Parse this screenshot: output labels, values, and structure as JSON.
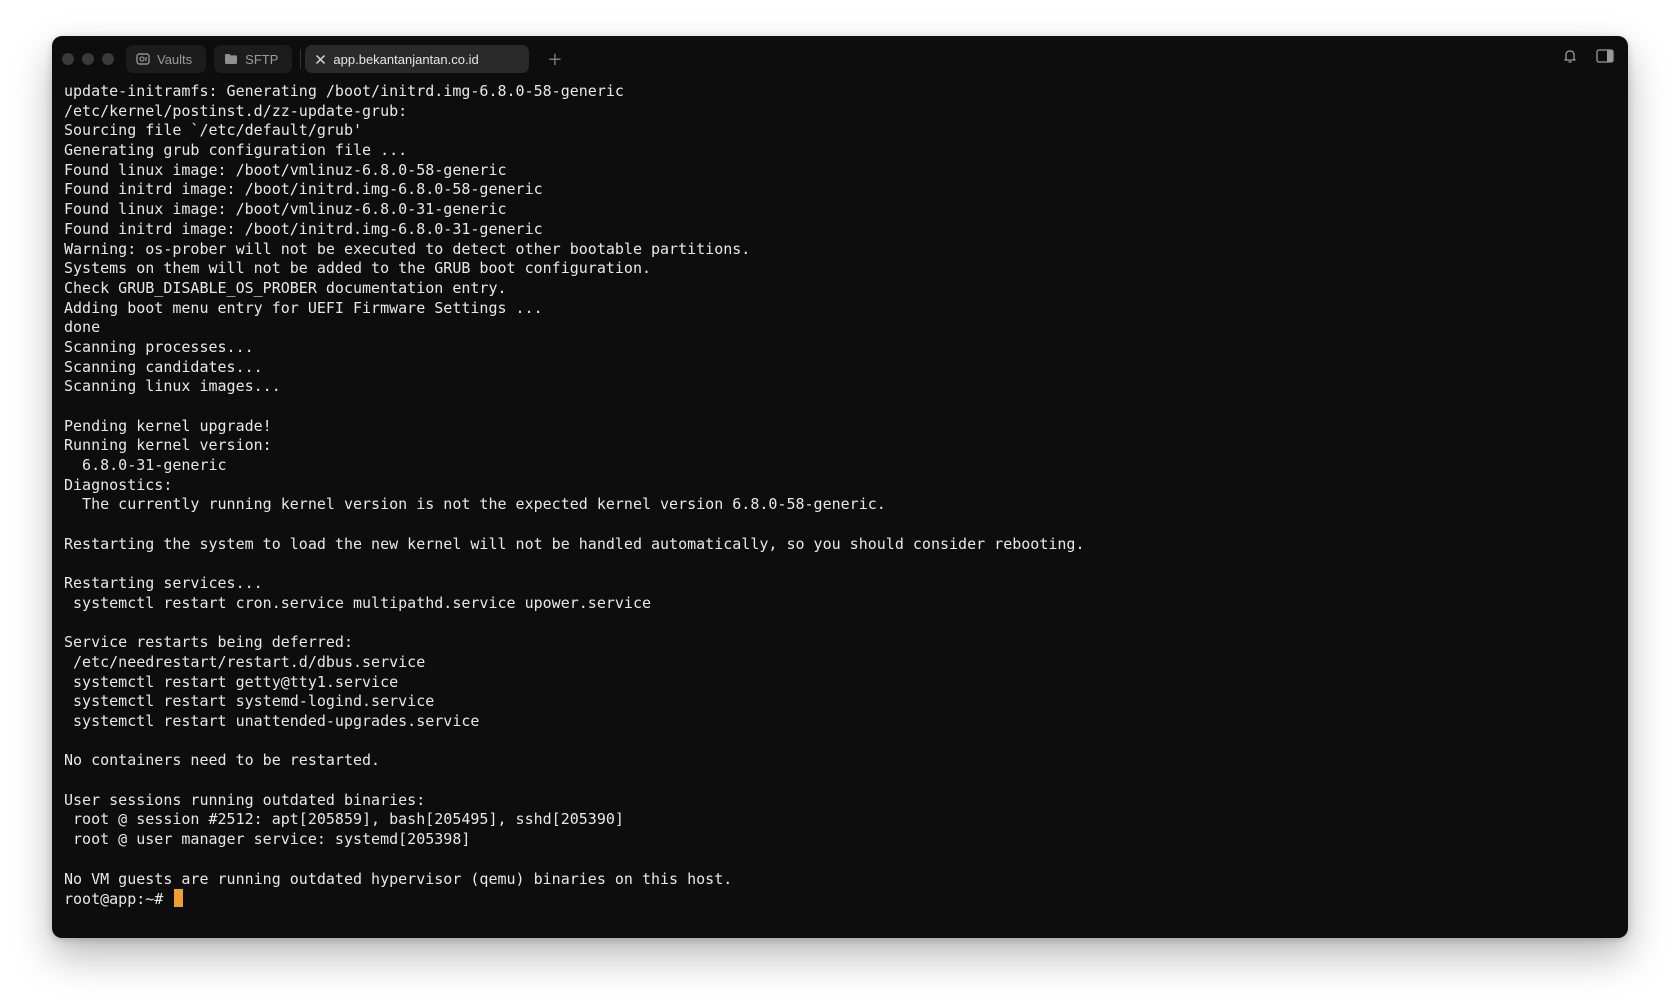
{
  "titlebar": {
    "tabs": [
      {
        "label": "Vaults",
        "icon": "vault-icon"
      },
      {
        "label": "SFTP",
        "icon": "folder-icon"
      },
      {
        "label": "app.bekantanjantan.co.id",
        "icon": "close-icon",
        "active": true
      }
    ],
    "new_tab": "+",
    "icons": [
      "bell-icon",
      "sidebar-panel-icon"
    ]
  },
  "terminal": {
    "lines": [
      "update-initramfs: Generating /boot/initrd.img-6.8.0-58-generic",
      "/etc/kernel/postinst.d/zz-update-grub:",
      "Sourcing file `/etc/default/grub'",
      "Generating grub configuration file ...",
      "Found linux image: /boot/vmlinuz-6.8.0-58-generic",
      "Found initrd image: /boot/initrd.img-6.8.0-58-generic",
      "Found linux image: /boot/vmlinuz-6.8.0-31-generic",
      "Found initrd image: /boot/initrd.img-6.8.0-31-generic",
      "Warning: os-prober will not be executed to detect other bootable partitions.",
      "Systems on them will not be added to the GRUB boot configuration.",
      "Check GRUB_DISABLE_OS_PROBER documentation entry.",
      "Adding boot menu entry for UEFI Firmware Settings ...",
      "done",
      "Scanning processes...",
      "Scanning candidates...",
      "Scanning linux images...",
      "",
      "Pending kernel upgrade!",
      "Running kernel version:",
      "  6.8.0-31-generic",
      "Diagnostics:",
      "  The currently running kernel version is not the expected kernel version 6.8.0-58-generic.",
      "",
      "Restarting the system to load the new kernel will not be handled automatically, so you should consider rebooting.",
      "",
      "Restarting services...",
      " systemctl restart cron.service multipathd.service upower.service",
      "",
      "Service restarts being deferred:",
      " /etc/needrestart/restart.d/dbus.service",
      " systemctl restart getty@tty1.service",
      " systemctl restart systemd-logind.service",
      " systemctl restart unattended-upgrades.service",
      "",
      "No containers need to be restarted.",
      "",
      "User sessions running outdated binaries:",
      " root @ session #2512: apt[205859], bash[205495], sshd[205390]",
      " root @ user manager service: systemd[205398]",
      "",
      "No VM guests are running outdated hypervisor (qemu) binaries on this host."
    ],
    "prompt": "root@app:~# ",
    "cursor_color": "#f0a030"
  }
}
